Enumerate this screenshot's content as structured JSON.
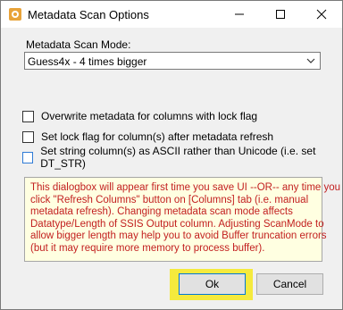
{
  "window": {
    "title": "Metadata Scan Options",
    "controls": {
      "minimize": "—",
      "maximize": "☐",
      "close": "✕"
    }
  },
  "scan_mode": {
    "label": "Metadata Scan Mode:",
    "selected": "Guess4x - 4 times bigger"
  },
  "options": [
    {
      "label": "Overwrite metadata for columns with lock flag",
      "checked": false
    },
    {
      "label": "Set lock flag for column(s) after metadata refresh",
      "checked": false
    },
    {
      "label": "Set string column(s) as ASCII rather than Unicode (i.e. set DT_STR)",
      "checked": false
    }
  ],
  "info": {
    "lines": [
      "This dialogbox will appear first time you save UI --OR-- any time you",
      "click \"Refresh Columns\" button on [Columns] tab (i.e. manual",
      "metadata refresh). Changing metadata scan mode affects",
      "Datatype/Length of SSIS Output column. Adjusting ScanMode to",
      "allow bigger length may help you to avoid Buffer truncation errors",
      "(but it may require more memory to process buffer)."
    ]
  },
  "buttons": {
    "ok": "Ok",
    "cancel": "Cancel"
  },
  "colors": {
    "highlight": "#f5ea3d",
    "info_text": "#c21f1f",
    "info_bg": "#ffffe1",
    "focus": "#0078d7"
  },
  "icons": {
    "app": "gear-icon",
    "dropdown": "chevron-down-icon"
  }
}
